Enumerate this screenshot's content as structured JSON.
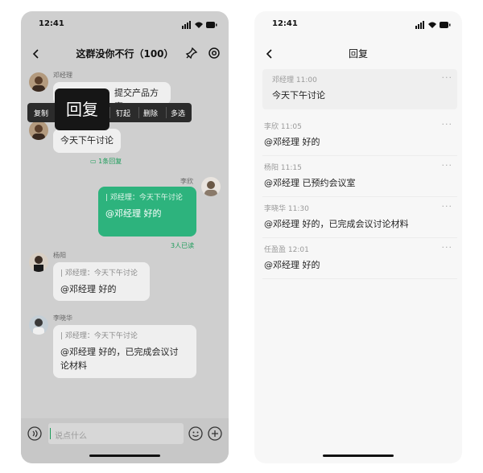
{
  "left": {
    "status_time": "12:41",
    "title": "这群没你不行（100）",
    "messages": [
      {
        "sender": "邓经理",
        "text": "提交产品方案"
      },
      {
        "text": "今天下午讨论",
        "reply_count": "1条回复"
      },
      {
        "sender": "李欣",
        "quote": "邓经理：今天下午讨论",
        "text": "@邓经理 好的",
        "read_note": "3人已读"
      },
      {
        "sender": "杨阳",
        "quote": "邓经理：今天下午讨论",
        "text": "@邓经理 好的"
      },
      {
        "sender": "李晓华",
        "quote": "邓经理：今天下午讨论",
        "text_line1": "@邓经理 好的，已完成会议讨",
        "text_line2": "论材料"
      }
    ],
    "context_menu": [
      "复制",
      "钉起",
      "删除",
      "多选"
    ],
    "reply_popup": "回复",
    "input_placeholder": "说点什么"
  },
  "right": {
    "status_time": "12:41",
    "title": "回复",
    "more": "···",
    "replies": [
      {
        "meta": "邓经理 11:00",
        "text": "今天下午讨论"
      },
      {
        "meta": "李欣 11:05",
        "text": "@邓经理  好的"
      },
      {
        "meta": "杨阳 11:15",
        "text": "@邓经理  已预约会议室"
      },
      {
        "meta": "李晓华 11:30",
        "text": "@邓经理  好的，已完成会议讨论材料"
      },
      {
        "meta": "任盈盈 12:01",
        "text": "@邓经理  好的"
      }
    ]
  },
  "colors": {
    "accent_green": "#2db37d",
    "dark_menu": "#2b2b2b"
  }
}
